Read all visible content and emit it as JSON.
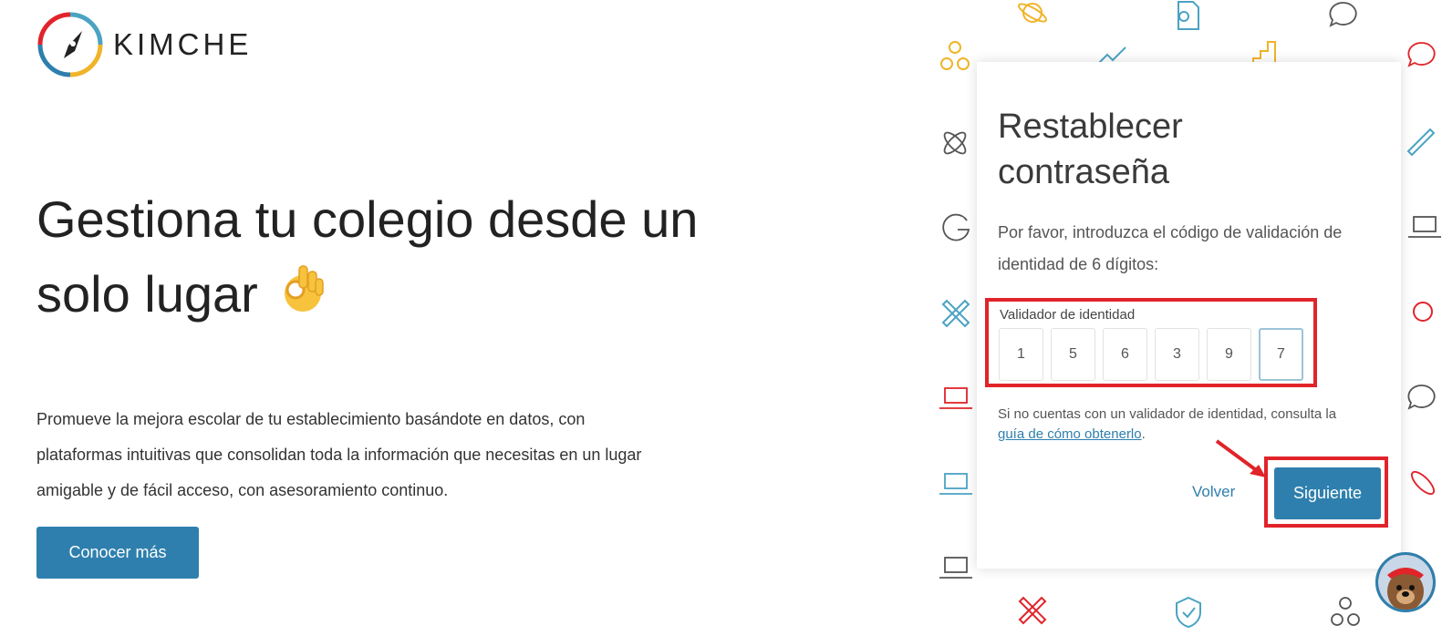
{
  "brand": {
    "name": "KIMCHE",
    "colors": {
      "red": "#e0242a",
      "blue": "#2e7fad",
      "yellow": "#f0b429",
      "teal": "#4ba3c3"
    }
  },
  "hero": {
    "headline": "Gestiona tu colegio desde un solo lugar",
    "emoji": "ok-hand-icon",
    "description": "Promueve la mejora escolar de tu establecimiento basándote en datos, con plataformas intuitivas que consolidan toda la información que necesitas en un lugar amigable y de fácil acceso, con asesoramiento continuo.",
    "cta_label": "Conocer más"
  },
  "reset_card": {
    "title": "Restablecer contraseña",
    "instructions": "Por favor, introduzca el código de validación de identidad de 6 dígitos:",
    "validator_label": "Validador de identidad",
    "digits": [
      "1",
      "5",
      "6",
      "3",
      "9",
      "7"
    ],
    "help_prefix": "Si no cuentas con un validador de identidad, consulta la ",
    "help_link": "guía de cómo obtenerlo",
    "help_suffix": ".",
    "back_label": "Volver",
    "next_label": "Siguiente"
  },
  "pattern_icons": [
    "planet-icon",
    "certificate-icon",
    "chat-icon",
    "circles-icon",
    "trend-up-icon",
    "bar-chart-icon",
    "atom-icon",
    "pencil-ruler-icon",
    "google-icon",
    "laptop-icon",
    "shield-icon",
    "compass-icon",
    "cloud-icon"
  ],
  "user": {
    "avatar": "dog-avatar-icon"
  }
}
